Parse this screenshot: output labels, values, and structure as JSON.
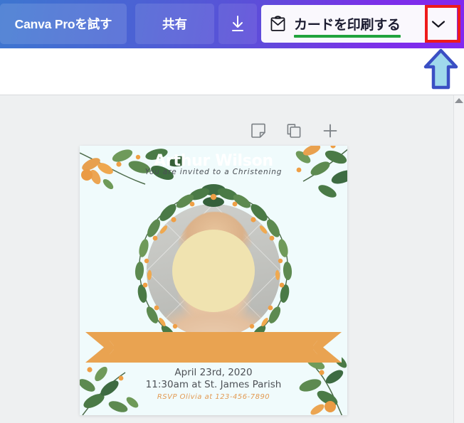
{
  "toolbar": {
    "try_pro_label": "Canva Proを試す",
    "share_label": "共有",
    "download_icon": "download-icon",
    "print_icon": "envelope-icon",
    "print_label": "カードを印刷する",
    "print_caret_icon": "chevron-down-icon",
    "underline_color": "#21a33d",
    "highlight_color": "#ee1b1b",
    "arrow_fill": "#9fd9ec",
    "arrow_stroke": "#3a4fc4"
  },
  "page_tools": {
    "notes_icon": "sticky-note-icon",
    "duplicate_icon": "duplicate-page-icon",
    "add_icon": "add-page-icon"
  },
  "scrollbar": {
    "up_arrow_icon": "scroll-up-arrow-icon"
  },
  "card": {
    "subtitle": "You are invited to a Christening",
    "name": "Arthur Wilson",
    "date": "April 23rd, 2020",
    "venue": "11:30am at St. James Parish",
    "rsvp": "RSVP Olivia at 123-456-7890",
    "background_color": "#f0fbfc",
    "banner_color": "#e9a351",
    "leaf_color_light": "#7a9c5c",
    "leaf_color_dark": "#3d6b42",
    "berry_color": "#eb9a42",
    "redaction_color": "#f0e3b0"
  }
}
